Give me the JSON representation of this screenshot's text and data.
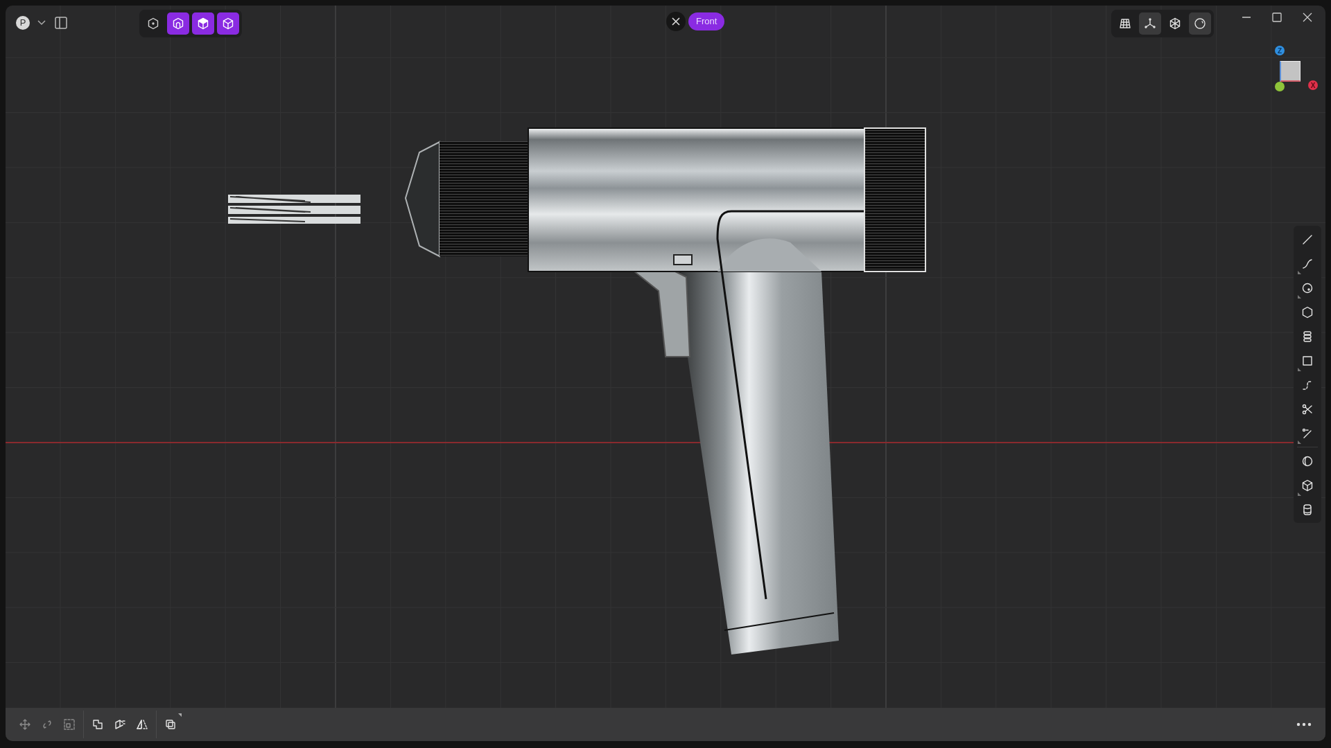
{
  "account": {
    "initial": "P"
  },
  "view_modes": [
    {
      "selected": false
    },
    {
      "selected": true
    },
    {
      "selected": true
    },
    {
      "selected": true
    }
  ],
  "view": {
    "label": "Front"
  },
  "render_modes": [
    {
      "selected": false
    },
    {
      "selected": true
    },
    {
      "selected": false
    },
    {
      "selected": true
    }
  ],
  "gizmo_axes": [
    {
      "label": "Z",
      "color": "#2f8fe0"
    },
    {
      "label": "X",
      "color": "#e0304a"
    },
    {
      "color": "#8fc43a"
    }
  ],
  "side_tools": [
    {
      "submenu": false
    },
    {
      "submenu": true
    },
    {
      "submenu": true
    },
    {
      "submenu": false
    },
    {
      "submenu": false
    },
    {
      "submenu": true
    },
    {
      "submenu": false
    },
    {
      "submenu": false
    },
    {
      "submenu": true
    },
    {
      "submenu": false
    },
    {
      "submenu": true
    },
    {
      "submenu": false
    }
  ],
  "bottom_tools": [
    [
      {
        "disabled": true,
        "submenu": false
      },
      {
        "disabled": true,
        "submenu": false
      },
      {
        "disabled": true,
        "submenu": false
      }
    ],
    [
      {
        "disabled": false,
        "submenu": false
      },
      {
        "disabled": false,
        "submenu": false
      },
      {
        "disabled": false,
        "submenu": false
      }
    ],
    [
      {
        "disabled": false,
        "submenu": true
      }
    ]
  ]
}
